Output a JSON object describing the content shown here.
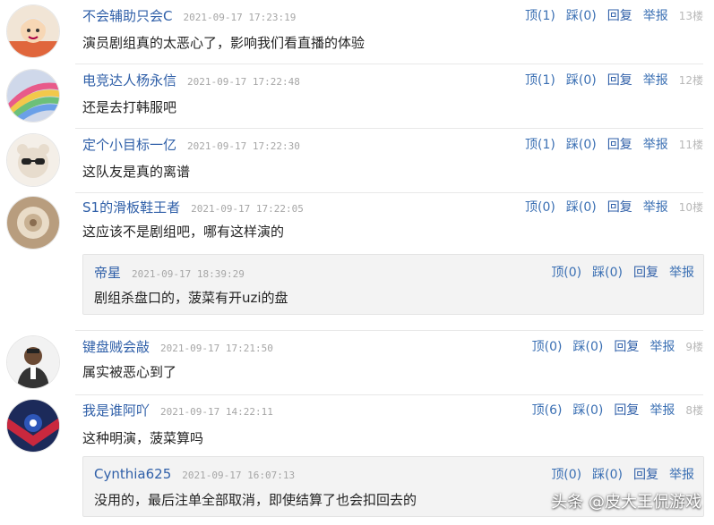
{
  "labels": {
    "ding": "顶",
    "cai": "踩",
    "reply": "回复",
    "report": "举报"
  },
  "comments": [
    {
      "user": "不会辅助只会C",
      "time": "2021-09-17 17:23:19",
      "ding": "顶(1)",
      "cai": "踩(0)",
      "floor": "13楼",
      "content": "演员剧组真的太恶心了，影响我们看直播的体验",
      "avatar": "avatar-cartoon-icon"
    },
    {
      "user": "电竞达人杨永信",
      "time": "2021-09-17 17:22:48",
      "ding": "顶(1)",
      "cai": "踩(0)",
      "floor": "12楼",
      "content": "还是去打韩服吧",
      "avatar": "avatar-rainbow-icon"
    },
    {
      "user": "定个小目标一亿",
      "time": "2021-09-17 17:22:30",
      "ding": "顶(1)",
      "cai": "踩(0)",
      "floor": "11楼",
      "content": "这队友是真的离谱",
      "avatar": "avatar-sunglasses-icon"
    },
    {
      "user": "S1的滑板鞋王者",
      "time": "2021-09-17 17:22:05",
      "ding": "顶(0)",
      "cai": "踩(0)",
      "floor": "10楼",
      "content": "这应该不是剧组吧，哪有这样演的",
      "avatar": "avatar-round-icon",
      "reply": {
        "user": "帝星",
        "time": "2021-09-17 18:39:29",
        "ding": "顶(0)",
        "cai": "踩(0)",
        "content": "剧组杀盘口的，菠菜有开uzi的盘"
      }
    },
    {
      "user": "键盘贼会敲",
      "time": "2021-09-17 17:21:50",
      "ding": "顶(0)",
      "cai": "踩(0)",
      "floor": "9楼",
      "content": "属实被恶心到了",
      "avatar": "avatar-person-icon"
    },
    {
      "user": "我是谁阿吖",
      "time": "2021-09-17 14:22:11",
      "ding": "顶(6)",
      "cai": "踩(0)",
      "floor": "8楼",
      "content": "这种明演，菠菜算吗",
      "avatar": "avatar-emblem-icon",
      "reply": {
        "user": "Cynthia625",
        "time": "2021-09-17 16:07:13",
        "ding": "顶(0)",
        "cai": "踩(0)",
        "content": "没用的，最后注单全部取消，即使结算了也会扣回去的"
      }
    }
  ],
  "watermark": "头条 @皮大王侃游戏",
  "colors": {
    "username": "#2f5fa8",
    "timestamp": "#a6a6a6",
    "floor": "#b8b8b8",
    "reply_bg": "#f3f3f3"
  }
}
